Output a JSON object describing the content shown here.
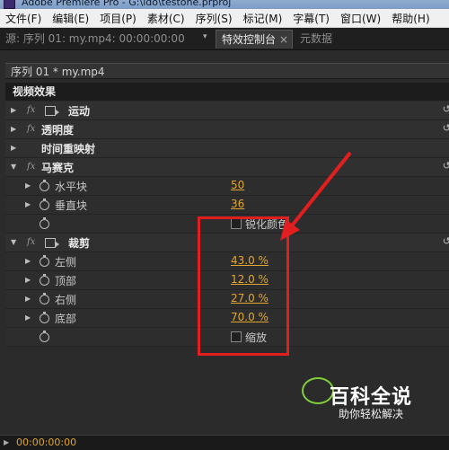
{
  "window": {
    "title": "Adobe Premiere Pro - G:\\ldo\\testone.prproj"
  },
  "menu": [
    "文件(F)",
    "编辑(E)",
    "项目(P)",
    "素材(C)",
    "序列(S)",
    "标记(M)",
    "字幕(T)",
    "窗口(W)",
    "帮助(H)"
  ],
  "tabs": {
    "source": "源: 序列 01: my.mp4: 00:00:00:00",
    "effect_controls": "特效控制台",
    "close": "×",
    "metadata": "元数据"
  },
  "sequence": "序列 01 * my.mp4",
  "section": "视频效果",
  "effects": {
    "motion": "运动",
    "opacity": "透明度",
    "time_remap": "时间重映射",
    "mosaic": {
      "name": "马赛克",
      "horizontal_label": "水平块",
      "horizontal_value": "50",
      "vertical_label": "垂直块",
      "vertical_value": "36",
      "sharpen_label": "锐化颜色"
    },
    "crop": {
      "name": "裁剪",
      "left_label": "左侧",
      "left_value": "43.0 %",
      "top_label": "顶部",
      "top_value": "12.0 %",
      "right_label": "右侧",
      "right_value": "27.0 %",
      "bottom_label": "底部",
      "bottom_value": "70.0 %",
      "zoom_label": "缩放"
    }
  },
  "fx_mark": "fx",
  "timecode": "00:00:00:00",
  "watermark": {
    "title": "百科全说",
    "subtitle": "助你轻松解决"
  },
  "colors": {
    "accent": "#e0a630",
    "highlight": "#e21e1e"
  }
}
